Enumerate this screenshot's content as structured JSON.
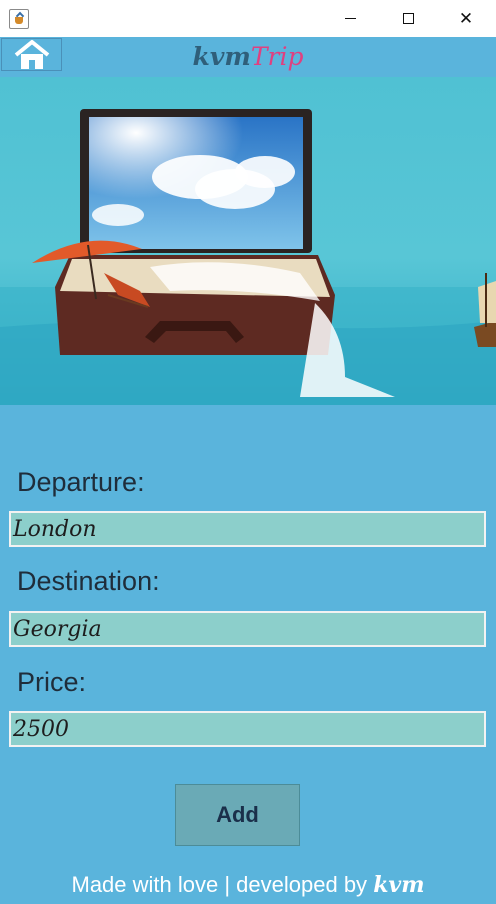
{
  "window": {
    "minimize": "—",
    "maximize": "□",
    "close": "✕"
  },
  "header": {
    "brand_part1": "kvm",
    "brand_part2": "Trip"
  },
  "icons": {
    "app": "java-cup-icon",
    "home": "home-icon"
  },
  "form": {
    "departure_label": "Departure:",
    "departure_value": "London",
    "destination_label": "Destination:",
    "destination_value": "Georgia",
    "price_label": "Price:",
    "price_value": "2500",
    "add_label": "Add"
  },
  "footer": {
    "text": "Made with love | developed by",
    "brand": "kvm"
  },
  "colors": {
    "background": "#5ab4dc",
    "field": "#8ccfcb",
    "button": "#6aaab6",
    "brand_dark": "#2f5f7a",
    "brand_accent": "#e04080"
  }
}
